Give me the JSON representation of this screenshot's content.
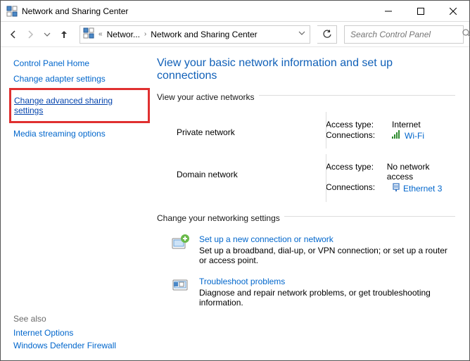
{
  "window": {
    "title": "Network and Sharing Center"
  },
  "breadcrumb": {
    "part1": "Networ...",
    "part2": "Network and Sharing Center"
  },
  "search": {
    "placeholder": "Search Control Panel"
  },
  "sidebar": {
    "home": "Control Panel Home",
    "adapter": "Change adapter settings",
    "advanced_line1": "Change advanced sharing",
    "advanced_line2": "settings",
    "streaming": "Media streaming options",
    "seealso_header": "See also",
    "internet_options": "Internet Options",
    "firewall": "Windows Defender Firewall"
  },
  "content": {
    "heading": "View your basic network information and set up connections",
    "active_header": "View your active networks",
    "net1": {
      "name": "Private network",
      "access_k": "Access type:",
      "access_v": "Internet",
      "conn_k": "Connections:",
      "conn_v": "Wi-Fi"
    },
    "net2": {
      "name": "Domain network",
      "access_k": "Access type:",
      "access_v": "No network access",
      "conn_k": "Connections:",
      "conn_v": "Ethernet 3"
    },
    "settings_header": "Change your networking settings",
    "task1": {
      "title": "Set up a new connection or network",
      "desc": "Set up a broadband, dial-up, or VPN connection; or set up a router or access point."
    },
    "task2": {
      "title": "Troubleshoot problems",
      "desc": "Diagnose and repair network problems, or get troubleshooting information."
    }
  }
}
